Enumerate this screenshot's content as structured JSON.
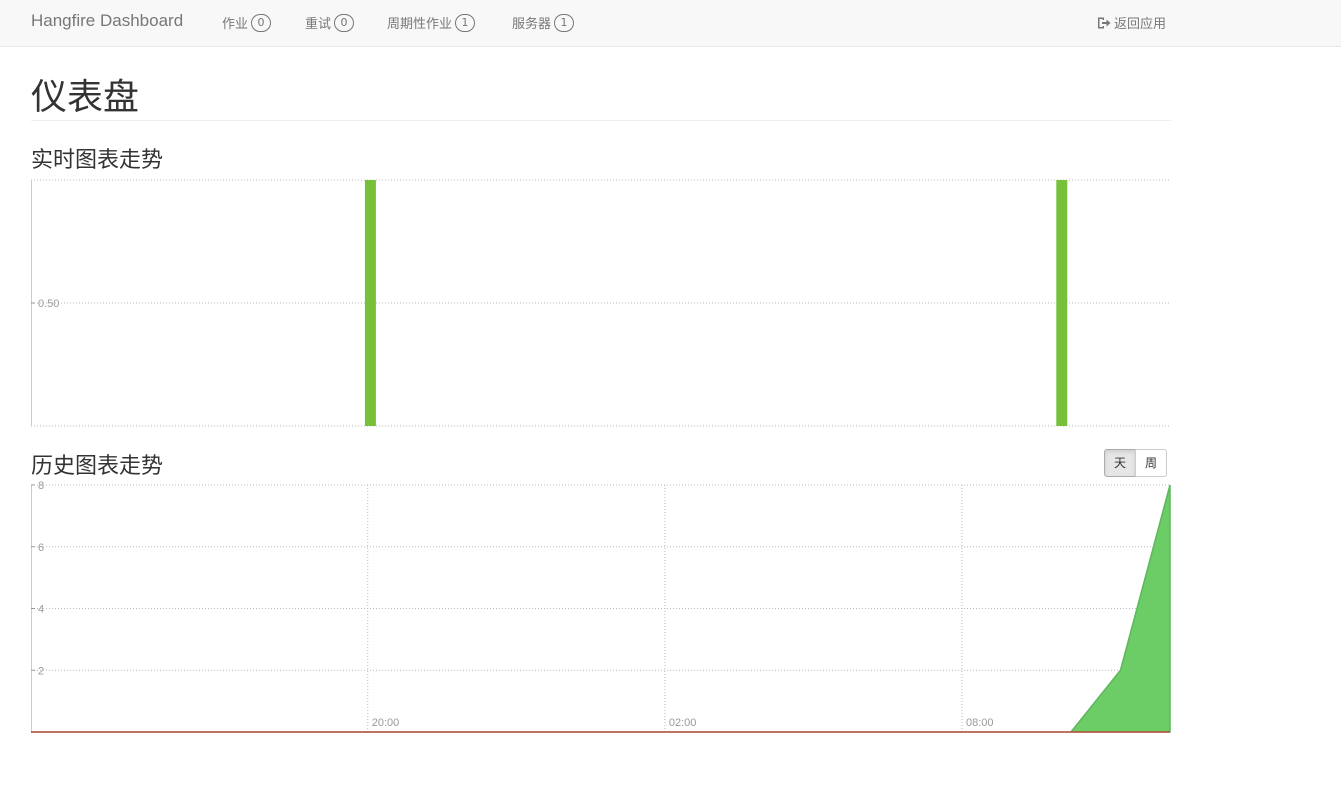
{
  "navbar": {
    "brand": "Hangfire Dashboard",
    "items": [
      {
        "label": "作业",
        "count": "0"
      },
      {
        "label": "重试",
        "count": "0"
      },
      {
        "label": "周期性作业",
        "count": "1"
      },
      {
        "label": "服务器",
        "count": "1"
      }
    ],
    "back_label": "返回应用",
    "back_icon": "sign-out-icon"
  },
  "page": {
    "title": "仪表盘",
    "realtime_title": "实时图表走势",
    "history_title": "历史图表走势",
    "period_buttons": [
      "天",
      "周"
    ],
    "active_period": "天"
  },
  "colors": {
    "succeeded": "#77C03A",
    "history_fill": "#6CCC66",
    "history_line": "#5DB75D",
    "failed": "#CC3333"
  },
  "chart_data": [
    {
      "type": "bar",
      "name": "realtime",
      "ylim": [
        0,
        1
      ],
      "y_ticks": [
        "0.50"
      ],
      "x_range": [
        0,
        1
      ],
      "bars": [
        {
          "x": 0.298,
          "value": 1
        },
        {
          "x": 0.905,
          "value": 1
        }
      ],
      "grid": true
    },
    {
      "type": "area",
      "name": "history",
      "ylim": [
        0,
        8
      ],
      "y_ticks": [
        "2",
        "4",
        "6",
        "8"
      ],
      "x_ticks": [
        "20:00",
        "02:00",
        "08:00"
      ],
      "x": [
        0,
        1,
        2,
        3,
        4,
        5,
        6,
        7,
        8,
        9,
        10,
        11,
        12,
        13,
        14,
        15,
        16,
        17,
        18,
        19,
        20,
        21,
        22,
        23
      ],
      "succeeded": [
        0,
        0,
        0,
        0,
        0,
        0,
        0,
        0,
        0,
        0,
        0,
        0,
        0,
        0,
        0,
        0,
        0,
        0,
        0,
        0,
        0,
        0,
        2,
        8
      ],
      "failed": [
        0,
        0,
        0,
        0,
        0,
        0,
        0,
        0,
        0,
        0,
        0,
        0,
        0,
        0,
        0,
        0,
        0,
        0,
        0,
        0,
        0,
        0,
        0,
        0
      ],
      "grid": true
    }
  ]
}
